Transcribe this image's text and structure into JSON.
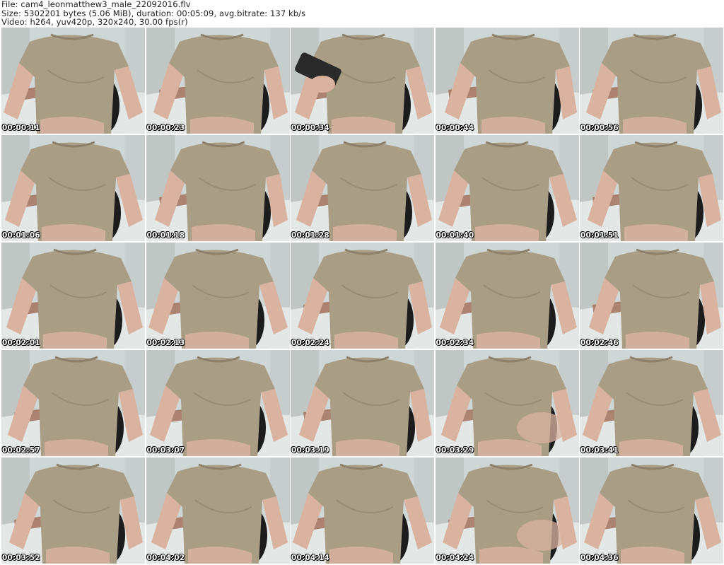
{
  "header": {
    "line1": "File: cam4_leonmatthew3_male_22092016.flv",
    "line2": "Size: 5302201 bytes (5.06 MiB), duration: 00:05:09, avg.bitrate: 137 kb/s",
    "line3": "Video: h264, yuv420p, 320x240, 30.00 fps(r)"
  },
  "thumbnails": [
    {
      "timestamp": "00:00:11"
    },
    {
      "timestamp": "00:00:23"
    },
    {
      "timestamp": "00:00:34"
    },
    {
      "timestamp": "00:00:44"
    },
    {
      "timestamp": "00:00:56"
    },
    {
      "timestamp": "00:01:06"
    },
    {
      "timestamp": "00:01:18"
    },
    {
      "timestamp": "00:01:28"
    },
    {
      "timestamp": "00:01:40"
    },
    {
      "timestamp": "00:01:51"
    },
    {
      "timestamp": "00:02:01"
    },
    {
      "timestamp": "00:02:13"
    },
    {
      "timestamp": "00:02:24"
    },
    {
      "timestamp": "00:02:34"
    },
    {
      "timestamp": "00:02:46"
    },
    {
      "timestamp": "00:02:57"
    },
    {
      "timestamp": "00:03:07"
    },
    {
      "timestamp": "00:03:19"
    },
    {
      "timestamp": "00:03:29"
    },
    {
      "timestamp": "00:03:41"
    },
    {
      "timestamp": "00:03:52"
    },
    {
      "timestamp": "00:04:02"
    },
    {
      "timestamp": "00:04:14"
    },
    {
      "timestamp": "00:04:24"
    },
    {
      "timestamp": "00:04:36"
    }
  ],
  "colors": {
    "shirt": "#a99d85",
    "shirt_shadow": "#8c806a",
    "skin": "#d9b3a0",
    "wall": "#cfd6d6",
    "floor": "#e3e7e6",
    "chair": "#1c1c1c",
    "phone": "#2a2a2a"
  }
}
